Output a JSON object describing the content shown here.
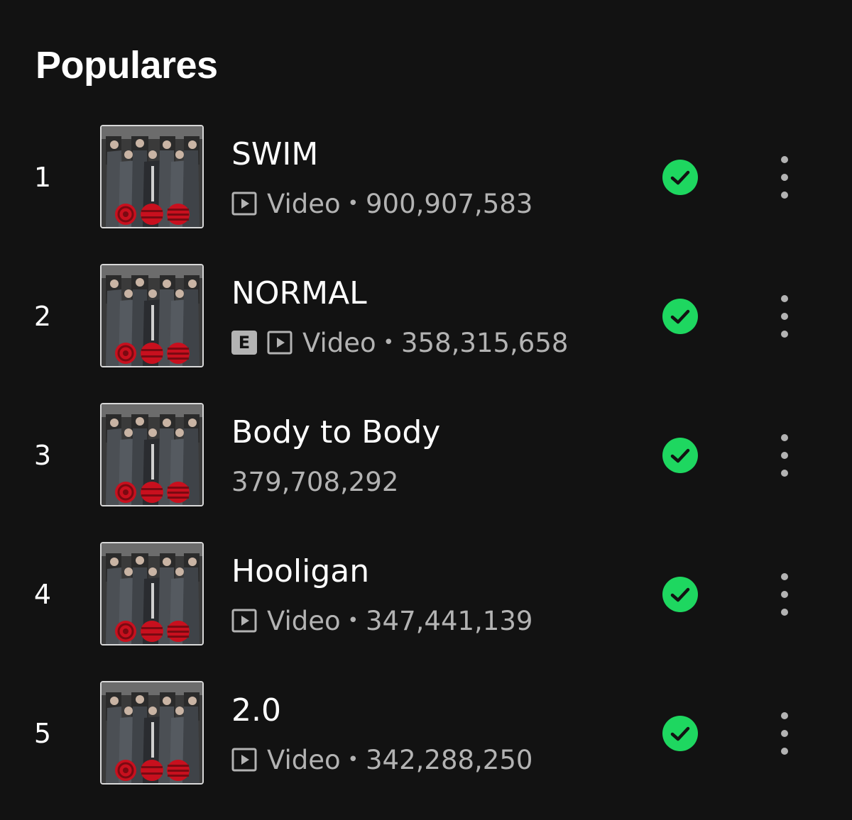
{
  "section": {
    "title": "Populares"
  },
  "tracks": [
    {
      "rank": "1",
      "title": "SWIM",
      "explicit": false,
      "has_video": true,
      "video_label": "Video",
      "separator": "•",
      "plays": "900,907,583",
      "saved": true,
      "cover_icon": "album-cover"
    },
    {
      "rank": "2",
      "title": "NORMAL",
      "explicit": true,
      "explicit_label": "E",
      "has_video": true,
      "video_label": "Video",
      "separator": "•",
      "plays": "358,315,658",
      "saved": true,
      "cover_icon": "album-cover"
    },
    {
      "rank": "3",
      "title": "Body to Body",
      "explicit": false,
      "has_video": false,
      "plays": "379,708,292",
      "saved": true,
      "cover_icon": "album-cover"
    },
    {
      "rank": "4",
      "title": "Hooligan",
      "explicit": false,
      "has_video": true,
      "video_label": "Video",
      "separator": "•",
      "plays": "347,441,139",
      "saved": true,
      "cover_icon": "album-cover"
    },
    {
      "rank": "5",
      "title": "2.0",
      "explicit": false,
      "has_video": true,
      "video_label": "Video",
      "separator": "•",
      "plays": "342,288,250",
      "saved": true,
      "cover_icon": "album-cover"
    }
  ],
  "icons": {
    "saved": "check-circle-icon",
    "more": "more-vertical-icon",
    "video": "video-play-icon"
  },
  "colors": {
    "background": "#121212",
    "text_primary": "#ffffff",
    "text_secondary": "#b3b3b3",
    "accent_green": "#1ed760",
    "cover_red": "#c8101e"
  }
}
